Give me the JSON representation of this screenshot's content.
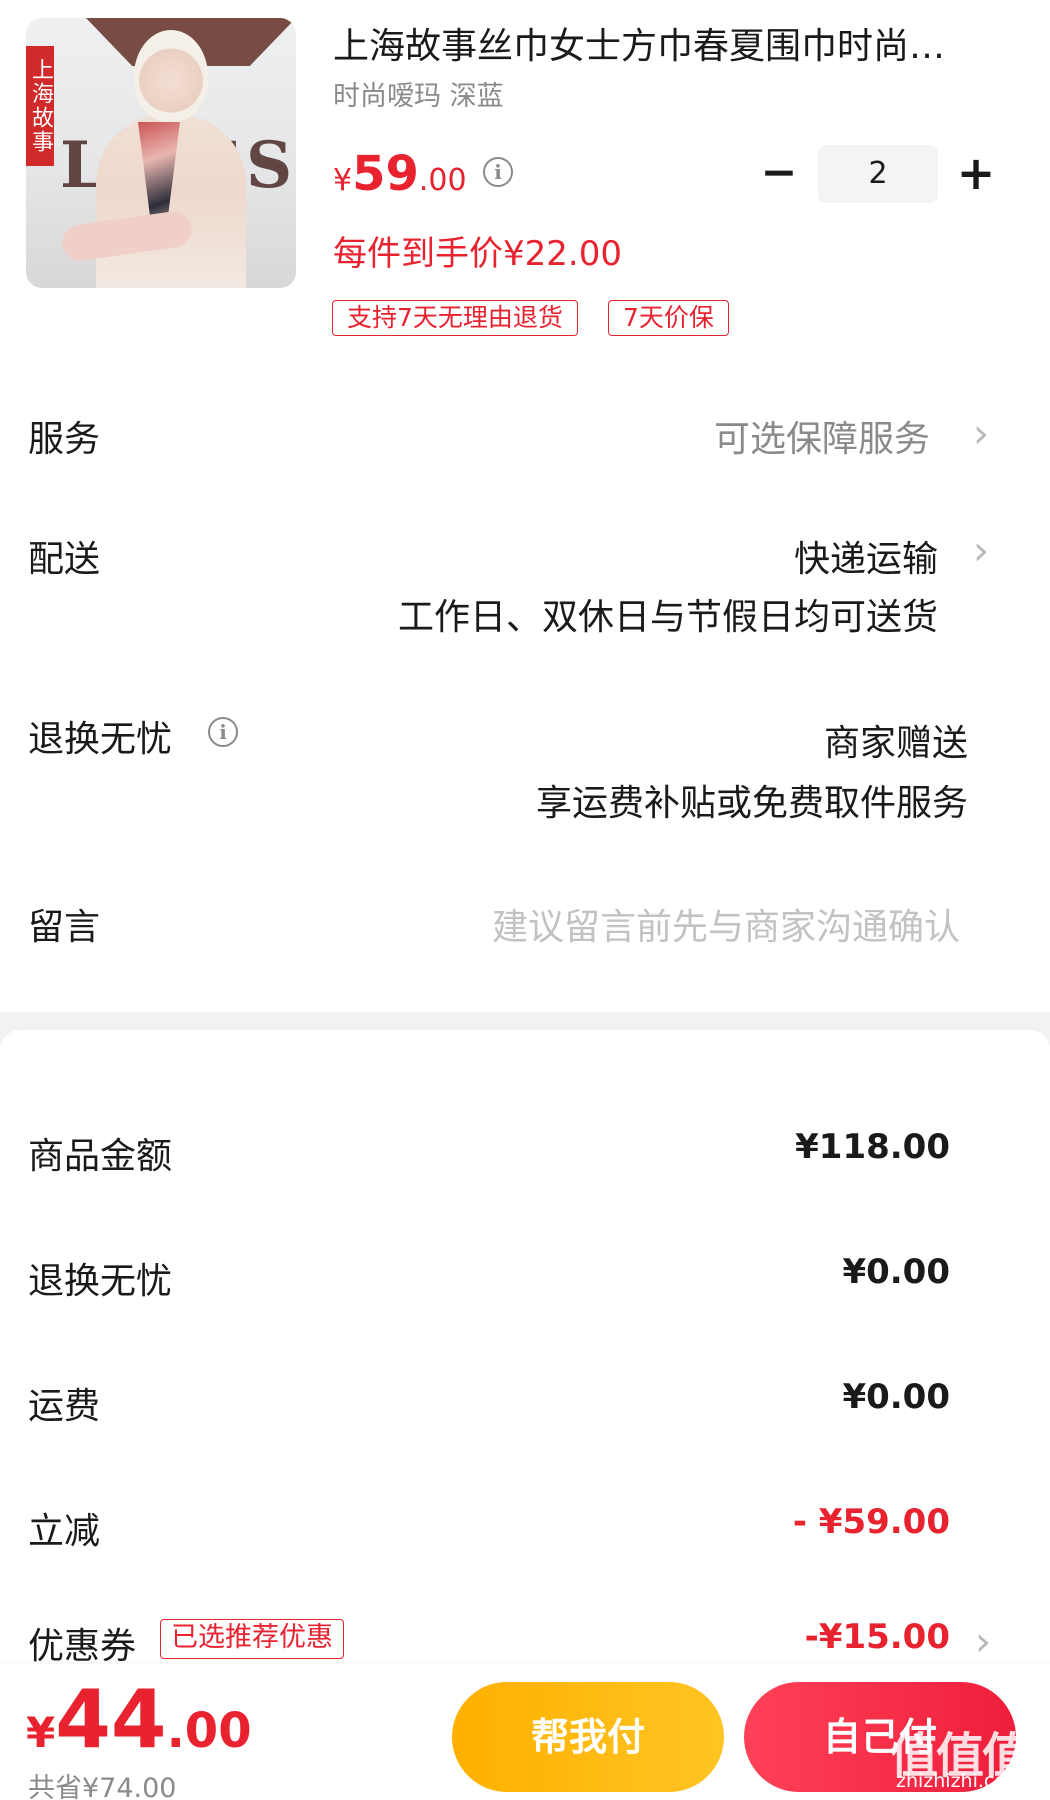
{
  "product": {
    "title": "上海故事丝巾女士方巾春夏围巾时尚…",
    "spec": "时尚嗳玛 深蓝",
    "price_symbol": "¥",
    "price_int": "59",
    "price_dec": ".00",
    "unit_price": "每件到手价¥22.00",
    "tags": [
      "支持7天无理由退货",
      "7天价保"
    ],
    "quantity": "2",
    "image_brand_text": "上海故事",
    "image_wall_text": "LAO'S"
  },
  "options": {
    "service": {
      "label": "服务",
      "value": "可选保障服务"
    },
    "shipping": {
      "label": "配送",
      "value": "快递运输",
      "sub": "工作日、双休日与节假日均可送货"
    },
    "returns": {
      "label": "退换无忧",
      "value": "商家赠送",
      "sub": "享运费补贴或免费取件服务"
    },
    "message": {
      "label": "留言",
      "placeholder": "建议留言前先与商家沟通确认"
    }
  },
  "summary": [
    {
      "label": "商品金额",
      "value": "¥118.00"
    },
    {
      "label": "退换无忧",
      "value": "¥0.00"
    },
    {
      "label": "运费",
      "value": "¥0.00"
    },
    {
      "label": "立减",
      "value": "- ¥59.00"
    },
    {
      "label": "优惠券",
      "tag": "已选推荐优惠",
      "value": "-¥15.00"
    }
  ],
  "bottom": {
    "total_symbol": "¥",
    "total_int": "44",
    "total_dec": ".00",
    "saved": "共省¥74.00",
    "help_pay": "帮我付",
    "self_pay": "自己付"
  },
  "watermark": {
    "text": "值值值",
    "url": "zhizhizhi.com"
  },
  "colors": {
    "accent_red": "#e8232f",
    "help_button": "#ffb000",
    "pay_button": "#ef1e3b"
  },
  "icons": {
    "info": "info-circle-icon",
    "chevron": "chevron-right-icon"
  }
}
